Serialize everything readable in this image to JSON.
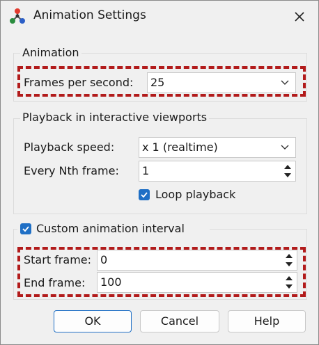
{
  "window": {
    "title": "Animation Settings"
  },
  "animation_group": {
    "title": "Animation",
    "fps_label": "Frames per second:",
    "fps_value": "25"
  },
  "playback_group": {
    "title": "Playback in interactive viewports",
    "speed_label": "Playback speed:",
    "speed_value": "x 1 (realtime)",
    "nth_label": "Every Nth frame:",
    "nth_value": "1",
    "loop_label": "Loop playback",
    "loop_checked": true
  },
  "interval_group": {
    "title": "Custom animation interval",
    "enabled": true,
    "start_label": "Start frame:",
    "start_value": "0",
    "end_label": "End frame:",
    "end_value": "100"
  },
  "buttons": {
    "ok": "OK",
    "cancel": "Cancel",
    "help": "Help"
  },
  "colors": {
    "highlight": "#b21b1b",
    "checkbox": "#1f6fc5"
  }
}
